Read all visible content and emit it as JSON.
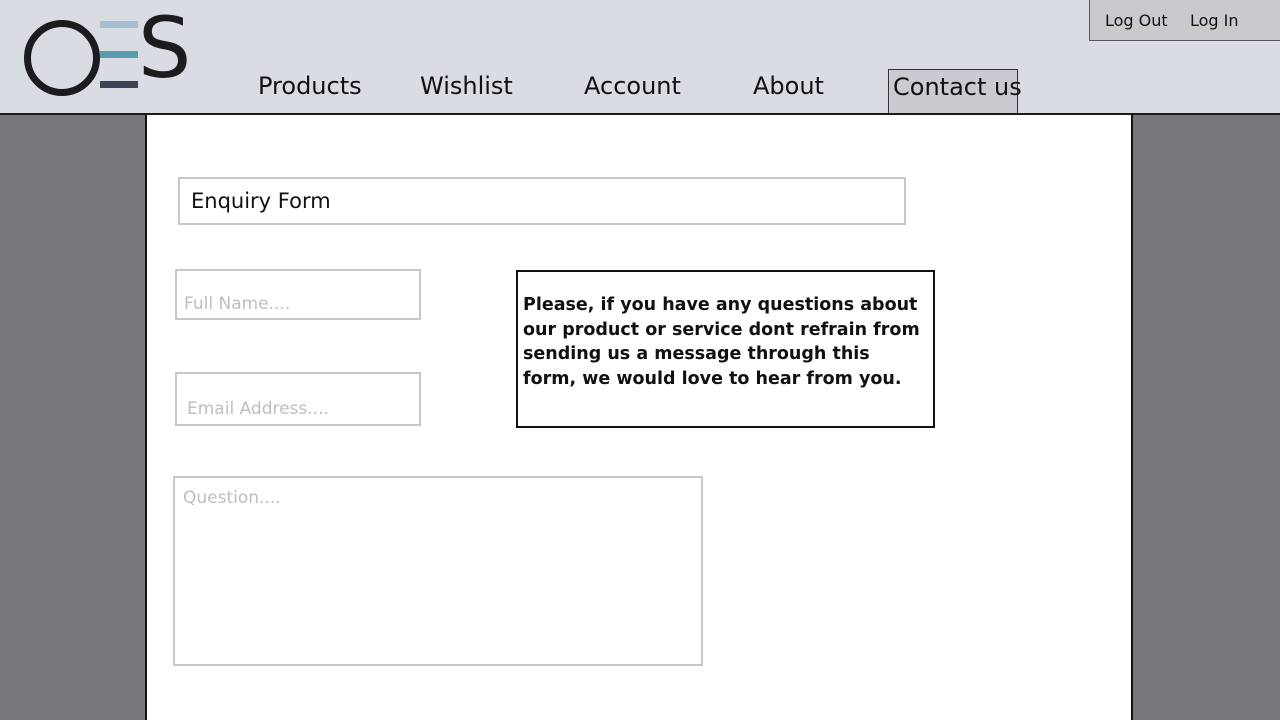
{
  "brand": {
    "logo_letters": "S"
  },
  "auth": {
    "logout_label": "Log Out",
    "login_label": "Log In"
  },
  "nav": {
    "products": "Products",
    "wishlist": "Wishlist",
    "account": "Account",
    "about": "About",
    "contact": "Contact us"
  },
  "form": {
    "title": "Enquiry Form",
    "name_placeholder": "Full Name....",
    "email_placeholder": "Email Address....",
    "question_placeholder": "Question....",
    "info_text": "Please, if you have any questions about our product or service dont refrain from sending us a message through this form, we would love to hear from you."
  },
  "colors": {
    "header_bg": "#d9dce3",
    "page_bg": "#76777b",
    "logo_bar_light": "#a8bdd0",
    "logo_bar_mid": "#5b9bb0",
    "logo_bar_dark": "#3b4354"
  }
}
